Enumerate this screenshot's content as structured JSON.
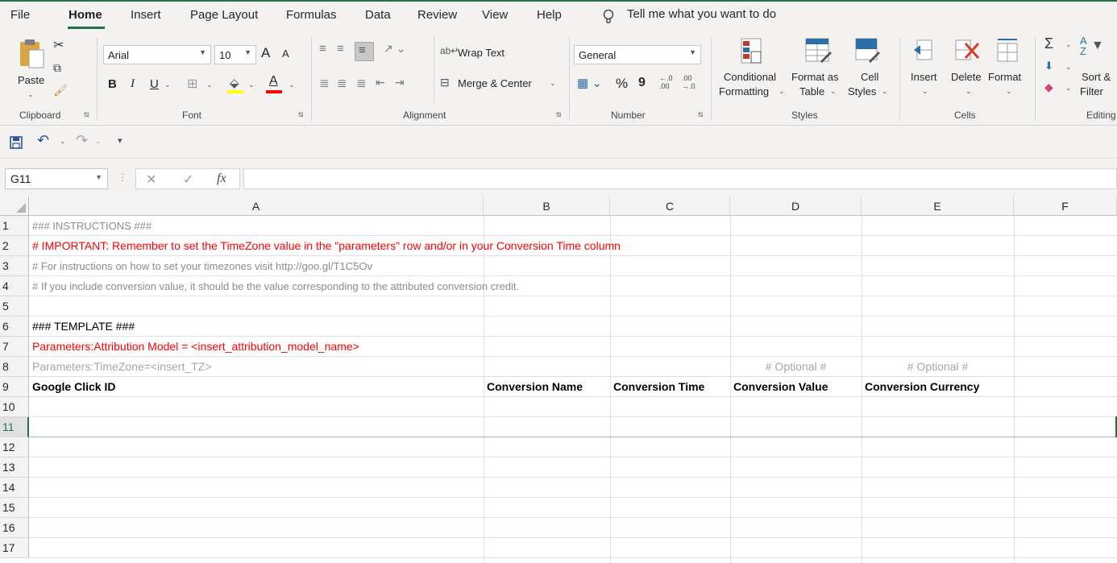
{
  "menu": {
    "tabs": [
      "File",
      "Home",
      "Insert",
      "Page Layout",
      "Formulas",
      "Data",
      "Review",
      "View",
      "Help"
    ],
    "active_tab": "Home",
    "tell_me": "Tell me what you want to do"
  },
  "ribbon": {
    "clipboard": {
      "paste": "Paste",
      "label": "Clipboard"
    },
    "font": {
      "name": "Arial",
      "size": "10",
      "bold": "B",
      "italic": "I",
      "underline": "U",
      "grow": "A",
      "shrink": "A",
      "color_letter": "A",
      "label": "Font"
    },
    "alignment": {
      "wrap_text": "Wrap Text",
      "merge_center": "Merge & Center",
      "label": "Alignment"
    },
    "number": {
      "format": "General",
      "percent": "%",
      "comma": "9",
      "label": "Number"
    },
    "styles": {
      "conditional": [
        "Conditional",
        "Formatting"
      ],
      "format_as": [
        "Format as",
        "Table"
      ],
      "cell_styles": [
        "Cell",
        "Styles"
      ],
      "label": "Styles"
    },
    "cells": {
      "insert": "Insert",
      "delete": "Delete",
      "format": "Format",
      "label": "Cells"
    },
    "editing": {
      "sort": [
        "Sort &",
        "Filter"
      ],
      "label": "Editing"
    }
  },
  "formula_bar": {
    "name_box": "G11",
    "fx": "fx",
    "formula": ""
  },
  "grid": {
    "columns": [
      "A",
      "B",
      "C",
      "D",
      "E",
      "F"
    ],
    "rows": [
      "1",
      "2",
      "3",
      "4",
      "5",
      "6",
      "7",
      "8",
      "9",
      "10",
      "11",
      "12",
      "13",
      "14",
      "15",
      "16",
      "17"
    ],
    "selected_cell": "G11",
    "cells": {
      "r1": "### INSTRUCTIONS ###",
      "r2": "# IMPORTANT: Remember to set the TimeZone value in the \"parameters\" row and/or in your Conversion Time column",
      "r3": "# For instructions on how to set your timezones visit http://goo.gl/T1C5Ov",
      "r4": "# If you include conversion value, it should be the value corresponding to the attributed conversion credit.",
      "r6": "### TEMPLATE ###",
      "r7": "Parameters:Attribution Model = <insert_attribution_model_name>",
      "r8": "Parameters:TimeZone=<insert_TZ>",
      "d8": "# Optional #",
      "e8": "# Optional #",
      "a9": "Google Click ID",
      "b9": "Conversion Name",
      "c9": "Conversion Time",
      "d9": "Conversion Value",
      "e9": "Conversion Currency"
    }
  },
  "colors": {
    "accent": "#217346",
    "red_text": "#ff0000",
    "gray_text": "#8c8c8c"
  }
}
